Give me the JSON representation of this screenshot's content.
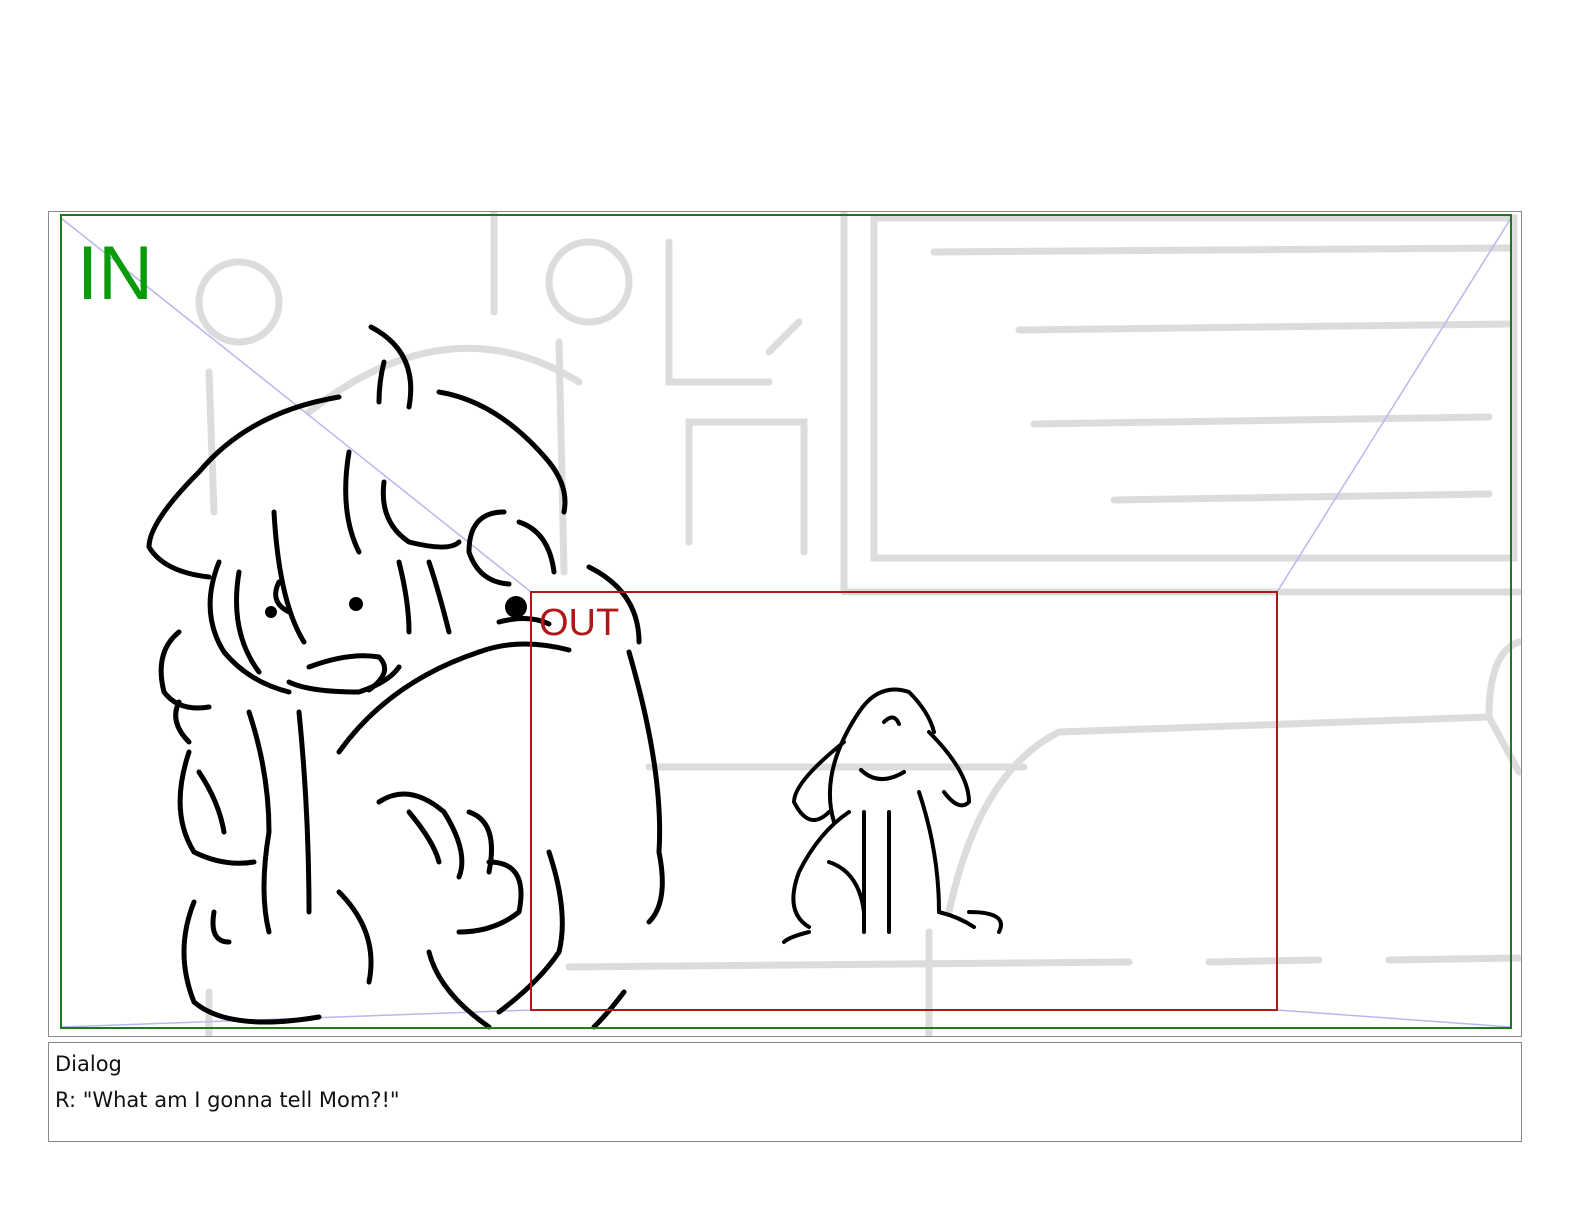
{
  "panel": {
    "in_label": "IN",
    "out_label": "OUT",
    "colors": {
      "in_frame": "#1f7a1f",
      "out_frame": "#b01818",
      "guide_lines": "#b8b8f0",
      "background_sketch": "#dcdcdc",
      "character_ink": "#000000"
    }
  },
  "dialog": {
    "title": "Dialog",
    "line": "R: \"What am I gonna tell Mom?!\""
  }
}
